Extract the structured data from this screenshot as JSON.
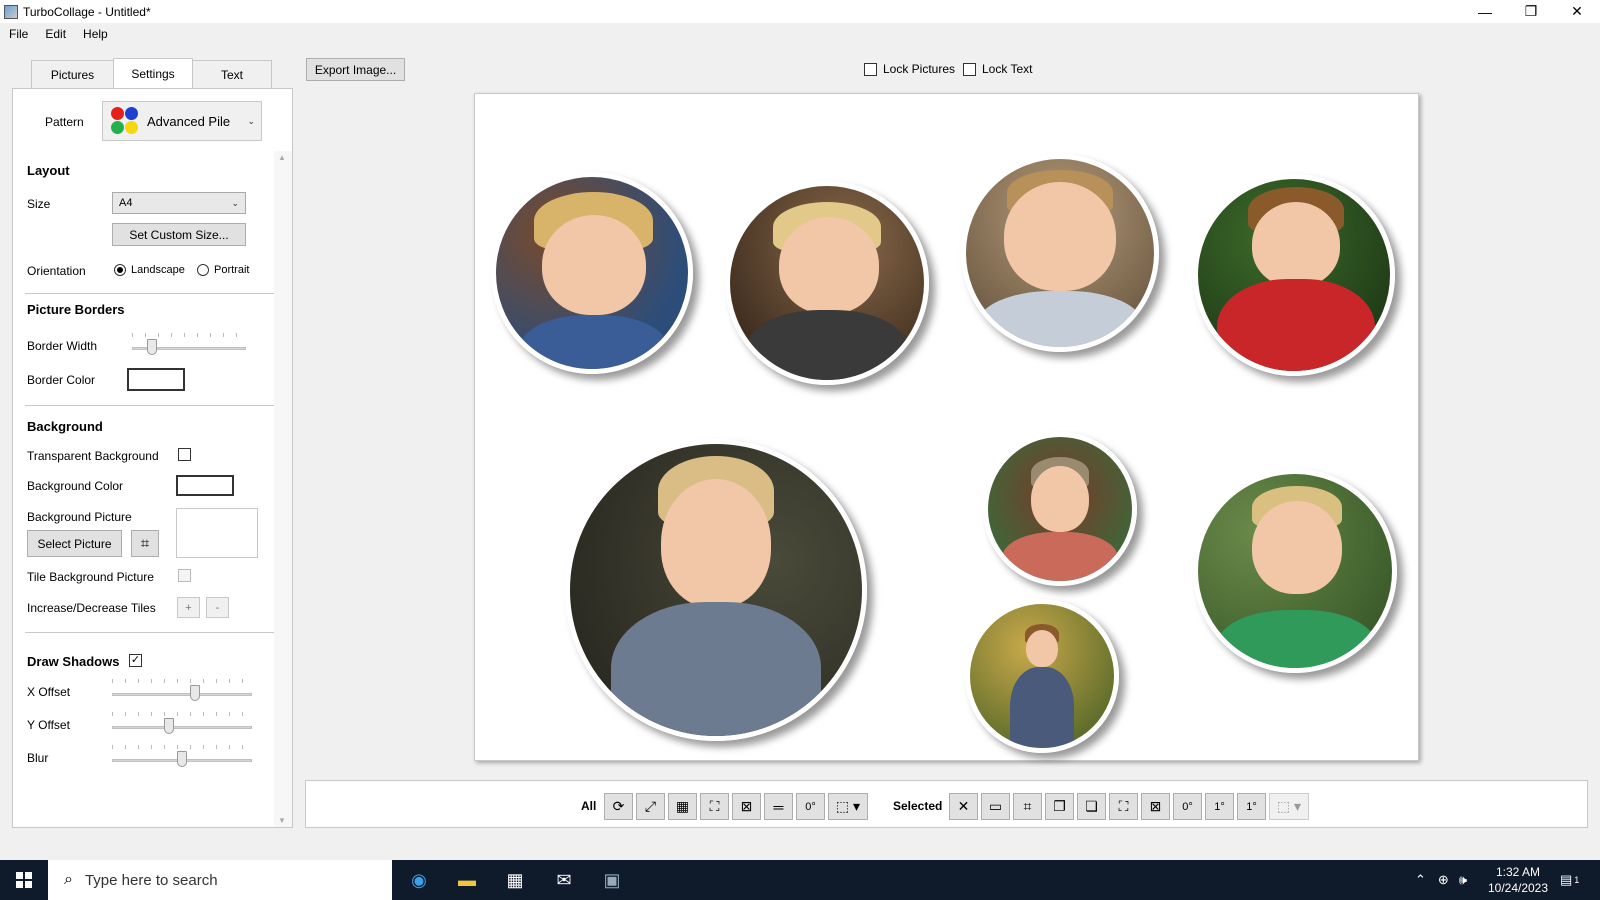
{
  "window": {
    "title": "TurboCollage - Untitled*",
    "minimize": "—",
    "maximize": "❐",
    "close": "✕"
  },
  "menu": {
    "file": "File",
    "edit": "Edit",
    "help": "Help"
  },
  "tabs": {
    "pictures": "Pictures",
    "settings": "Settings",
    "text": "Text"
  },
  "settings": {
    "pattern_label": "Pattern",
    "pattern_value": "Advanced Pile",
    "layout_title": "Layout",
    "size_label": "Size",
    "size_value": "A4",
    "custom_size_button": "Set Custom Size...",
    "orientation_label": "Orientation",
    "landscape_label": "Landscape",
    "portrait_label": "Portrait",
    "orientation_value": "Landscape",
    "borders_title": "Picture Borders",
    "border_width_label": "Border Width",
    "border_width_level": 0.15,
    "border_color_label": "Border Color",
    "border_color": "#ffffff",
    "background_title": "Background",
    "transparent_label": "Transparent Background",
    "transparent_checked": false,
    "bg_color_label": "Background Color",
    "bg_color": "#ffffff",
    "bg_picture_label": "Background Picture",
    "select_picture_button": "Select Picture",
    "tile_label": "Tile Background Picture",
    "tile_checked": false,
    "tiles_label": "Increase/Decrease Tiles",
    "tiles_plus": "+",
    "tiles_minus": "-",
    "shadows_label": "Draw Shadows",
    "shadows_checked": true,
    "x_offset_label": "X Offset",
    "x_offset_level": 0.6,
    "y_offset_label": "Y Offset",
    "y_offset_level": 0.4,
    "blur_label": "Blur",
    "blur_level": 0.5
  },
  "top": {
    "export_button": "Export Image...",
    "lock_pictures_label": "Lock Pictures",
    "lock_pictures_checked": false,
    "lock_text_label": "Lock Text",
    "lock_text_checked": false
  },
  "toolbar": {
    "all_label": "All",
    "selected_label": "Selected",
    "rotate_zero_label": "0°",
    "rotate_one_label": "1°"
  },
  "taskbar": {
    "search_placeholder": "Type here to search",
    "time": "1:32 AM",
    "date": "10/24/2023",
    "notification_count": "1"
  },
  "colors": {
    "canvas_bg": "#ffffff",
    "taskbar_bg": "#0f1b2b",
    "pattern_red": "#e3201b",
    "pattern_blue": "#1f3fd1",
    "pattern_green": "#22b14c",
    "pattern_yellow": "#f5d80f"
  }
}
